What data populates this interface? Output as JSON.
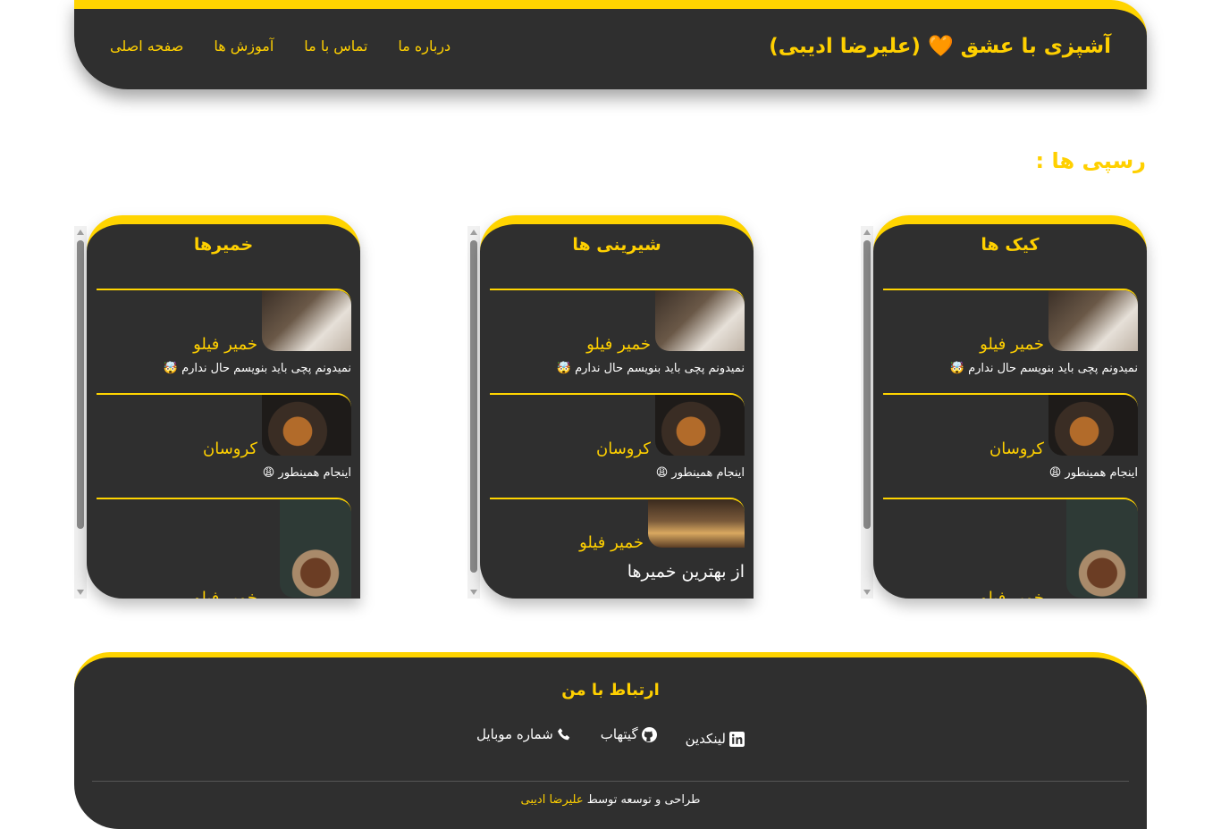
{
  "header": {
    "title": "آشپزی با عشق 🧡 (علیرضا ادیبی)",
    "nav": [
      "صفحه اصلی",
      "آموزش ها",
      "تماس با ما",
      "درباره ما"
    ]
  },
  "section_title": "رسپی ها :",
  "panels": [
    {
      "title": "کیک ها",
      "items": [
        {
          "name": "خمیر فیلو",
          "desc": "نمیدونم پچی باید بنویسم حال ندارم 🤯"
        },
        {
          "name": "کروسان",
          "desc": "اینجام همینطور 😩"
        },
        {
          "name": "خمیر فیلو",
          "desc": ""
        }
      ]
    },
    {
      "title": "شیرینی ها",
      "items": [
        {
          "name": "خمیر فیلو",
          "desc": "نمیدونم پچی باید بنویسم حال ندارم 🤯"
        },
        {
          "name": "کروسان",
          "desc": "اینجام همینطور 😩"
        },
        {
          "name": "خمیر فیلو",
          "desc": "از بهترین خمیرها"
        }
      ]
    },
    {
      "title": "خمیرها",
      "items": [
        {
          "name": "خمیر فیلو",
          "desc": "نمیدونم پچی باید بنویسم حال ندارم 🤯"
        },
        {
          "name": "کروسان",
          "desc": "اینجام همینطور 😩"
        },
        {
          "name": "خمیر فیلو",
          "desc": ""
        }
      ]
    }
  ],
  "footer": {
    "title": "ارتباط با من",
    "links": {
      "linkedin": "لینکدین",
      "github": "گیتهاب",
      "phone": "شماره موبایل"
    },
    "credit_prefix": "طراحی و توسعه توسط",
    "credit_author": "علیرضا ادیبی"
  },
  "colors": {
    "accent": "#ffd400",
    "panel_bg": "#2f2f2f"
  }
}
